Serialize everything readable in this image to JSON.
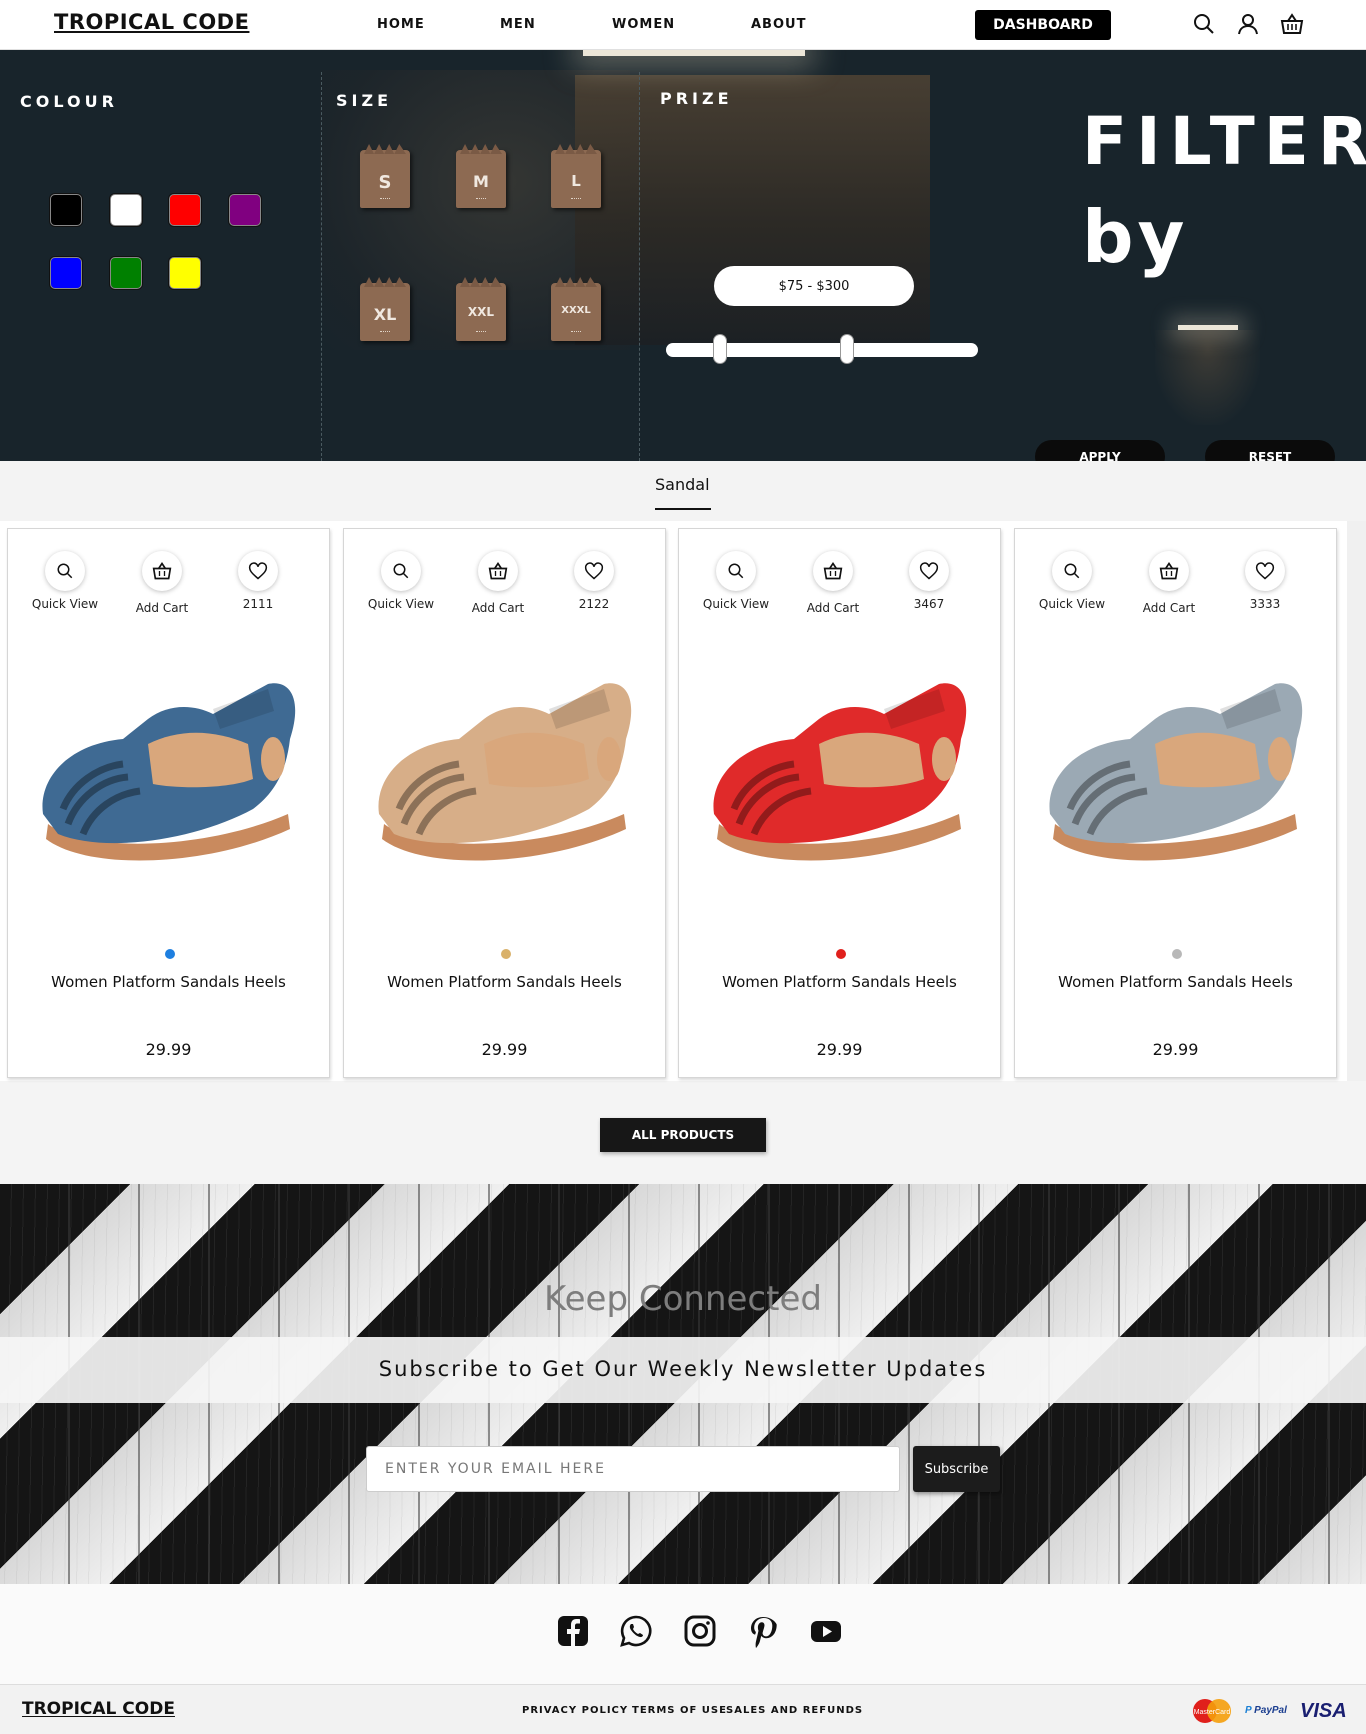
{
  "header": {
    "logo": "TROPICAL CODE",
    "nav": [
      "HOME",
      "MEN",
      "WOMEN",
      "ABOUT"
    ],
    "dashboard_label": "DASHBOARD",
    "icons": [
      "search-icon",
      "user-icon",
      "basket-icon"
    ]
  },
  "filter": {
    "colour_title": "COLOUR",
    "size_title": "SIZE",
    "prize_title": "PRIZE",
    "colours": [
      "#000000",
      "#ffffff",
      "#ff0000",
      "#800080",
      "#0000ff",
      "#008000",
      "#ffff00"
    ],
    "sizes": [
      "S",
      "M",
      "L",
      "XL",
      "XXL",
      "XXXL"
    ],
    "price_range": "$75 - $300",
    "price_min": 75,
    "price_max": 300,
    "heading_line1": "FILTER",
    "heading_line2": "by",
    "apply_label": "APPLY",
    "reset_label": "RESET"
  },
  "category_tab": "Sandal",
  "product_actions": {
    "quick_view": "Quick View",
    "add_cart": "Add Cart"
  },
  "products": [
    {
      "name": "Women Platform Sandals Heels",
      "price": "29.99",
      "likes": "2111",
      "color": "#1e7fe0",
      "shoe_color": "#3f6a93"
    },
    {
      "name": "Women Platform Sandals Heels",
      "price": "29.99",
      "likes": "2122",
      "color": "#d9b16a",
      "shoe_color": "#d7ae88"
    },
    {
      "name": "Women Platform Sandals Heels",
      "price": "29.99",
      "likes": "3467",
      "color": "#e0201c",
      "shoe_color": "#e02a2a"
    },
    {
      "name": "Women Platform Sandals Heels",
      "price": "29.99",
      "likes": "3333",
      "color": "#b8b8b8",
      "shoe_color": "#9ba9b4"
    }
  ],
  "all_products_label": "ALL PRODUCTS",
  "newsletter": {
    "title": "Keep Connected",
    "subtitle": "Subscribe to Get Our Weekly Newsletter Updates",
    "email_placeholder": "ENTER YOUR EMAIL HERE",
    "subscribe_label": "Subscribe"
  },
  "social_icons": [
    "facebook-icon",
    "whatsapp-icon",
    "instagram-icon",
    "pinterest-icon",
    "youtube-icon"
  ],
  "footer": {
    "logo": "TROPICAL CODE",
    "links": [
      "PRIVACY POLICY",
      "TERMS OF USE",
      "SALES AND REFUNDS"
    ],
    "payments": [
      "MasterCard",
      "PayPal",
      "VISA"
    ]
  }
}
